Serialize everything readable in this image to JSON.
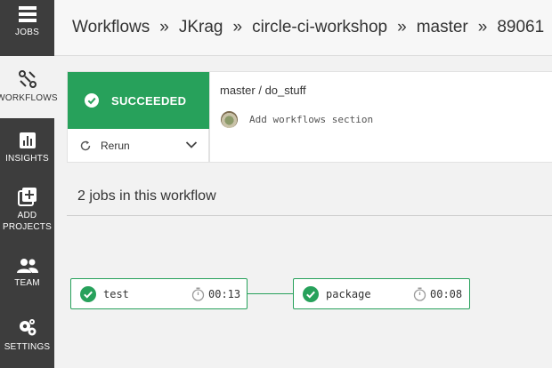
{
  "sidebar": {
    "items": [
      {
        "label": "JOBS",
        "icon": "jobs-icon",
        "active": false
      },
      {
        "label": "WORKFLOWS",
        "icon": "workflows-icon",
        "active": true
      },
      {
        "label": "INSIGHTS",
        "icon": "insights-icon",
        "active": false
      },
      {
        "label": "ADD\nPROJECTS",
        "icon": "add-projects-icon",
        "active": false
      },
      {
        "label": "TEAM",
        "icon": "team-icon",
        "active": false
      },
      {
        "label": "SETTINGS",
        "icon": "settings-icon",
        "active": false
      }
    ]
  },
  "header": {
    "breadcrumb": [
      "Workflows",
      "JKrag",
      "circle-ci-workshop",
      "master",
      "89061"
    ],
    "separator": "»"
  },
  "summary": {
    "status": "SUCCEEDED",
    "rerun_label": "Rerun",
    "branch_job": "master / do_stuff",
    "commit_message": "Add workflows section"
  },
  "jobs": {
    "heading": "2 jobs in this workflow",
    "items": [
      {
        "name": "test",
        "duration": "00:13",
        "status": "success"
      },
      {
        "name": "package",
        "duration": "00:08",
        "status": "success"
      }
    ]
  },
  "colors": {
    "success": "#27a15b",
    "sidebar_bg": "#3d3d3d",
    "page_bg": "#f2f2f2"
  }
}
